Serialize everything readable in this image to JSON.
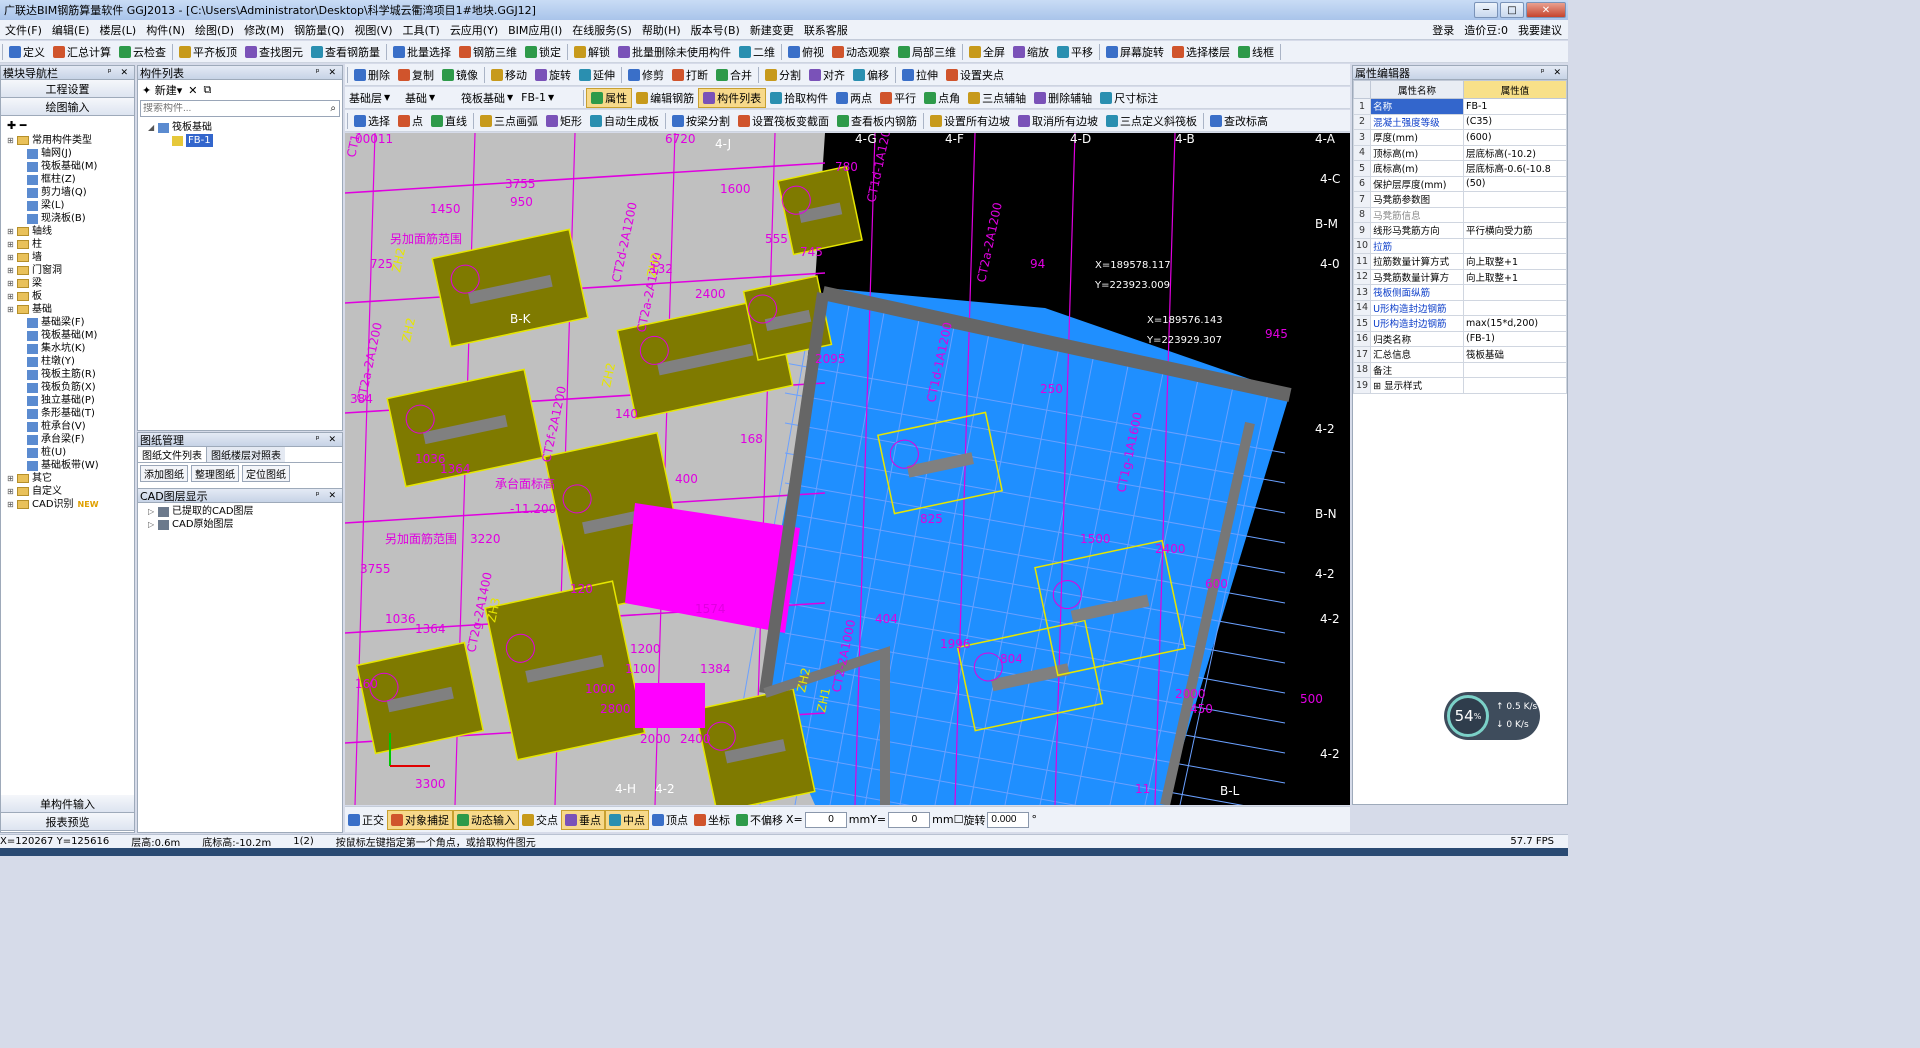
{
  "window": {
    "title": "广联达BIM钢筋算量软件 GGJ2013 - [C:\\Users\\Administrator\\Desktop\\科学城云衢湾项目1#地块.GGJ12]",
    "minimize": "─",
    "maximize": "□",
    "close": "✕"
  },
  "menu": {
    "items": [
      "文件(F)",
      "编辑(E)",
      "楼层(L)",
      "构件(N)",
      "绘图(D)",
      "修改(M)",
      "钢筋量(Q)",
      "视图(V)",
      "工具(T)",
      "云应用(Y)",
      "BIM应用(I)",
      "在线服务(S)",
      "帮助(H)",
      "版本号(B)",
      "新建变更",
      "联系客服"
    ],
    "right": [
      "登录",
      "造价豆:0",
      "我要建议"
    ]
  },
  "toolbar1": [
    "定义",
    "汇总计算",
    "云检查",
    "平齐板顶",
    "查找图元",
    "查看钢筋量",
    "批量选择",
    "钢筋三维",
    "锁定",
    "解锁",
    "批量删除未使用构件",
    "二维",
    "俯视",
    "动态观察",
    "局部三维",
    "全屏",
    "缩放",
    "平移",
    "屏幕旋转",
    "选择楼层",
    "线框"
  ],
  "toolbar2": [
    "删除",
    "复制",
    "镜像",
    "移动",
    "旋转",
    "延伸",
    "修剪",
    "打断",
    "合并",
    "分割",
    "对齐",
    "偏移",
    "拉伸",
    "设置夹点"
  ],
  "toolbar3": {
    "floor_type": "基础层",
    "floor": "基础",
    "category": "筏板基础",
    "member": "FB-1",
    "buttons": [
      "属性",
      "编辑钢筋",
      "构件列表",
      "拾取构件",
      "两点",
      "平行",
      "点角",
      "三点辅轴",
      "删除辅轴",
      "尺寸标注"
    ]
  },
  "toolbar4": [
    "选择",
    "点",
    "直线",
    "三点画弧",
    "矩形",
    "自动生成板",
    "按梁分割",
    "设置筏板变截面",
    "查看板内钢筋",
    "设置所有边坡",
    "取消所有边坡",
    "三点定义斜筏板",
    "查改标高"
  ],
  "nav": {
    "title": "模块导航栏",
    "btn1": "工程设置",
    "btn2": "绘图输入",
    "btn3": "单构件输入",
    "btn4": "报表预览",
    "tree": [
      {
        "t": "常用构件类型",
        "lvl": 0,
        "k": "fold"
      },
      {
        "t": "轴网(J)",
        "lvl": 1,
        "k": "item"
      },
      {
        "t": "筏板基础(M)",
        "lvl": 1,
        "k": "item"
      },
      {
        "t": "框柱(Z)",
        "lvl": 1,
        "k": "item"
      },
      {
        "t": "剪力墙(Q)",
        "lvl": 1,
        "k": "item"
      },
      {
        "t": "梁(L)",
        "lvl": 1,
        "k": "item"
      },
      {
        "t": "现浇板(B)",
        "lvl": 1,
        "k": "item"
      },
      {
        "t": "轴线",
        "lvl": 0,
        "k": "fold"
      },
      {
        "t": "柱",
        "lvl": 0,
        "k": "fold"
      },
      {
        "t": "墙",
        "lvl": 0,
        "k": "fold"
      },
      {
        "t": "门窗洞",
        "lvl": 0,
        "k": "fold"
      },
      {
        "t": "梁",
        "lvl": 0,
        "k": "fold"
      },
      {
        "t": "板",
        "lvl": 0,
        "k": "fold"
      },
      {
        "t": "基础",
        "lvl": 0,
        "k": "fold"
      },
      {
        "t": "基础梁(F)",
        "lvl": 1,
        "k": "item"
      },
      {
        "t": "筏板基础(M)",
        "lvl": 1,
        "k": "item"
      },
      {
        "t": "集水坑(K)",
        "lvl": 1,
        "k": "item"
      },
      {
        "t": "柱墩(Y)",
        "lvl": 1,
        "k": "item"
      },
      {
        "t": "筏板主筋(R)",
        "lvl": 1,
        "k": "item"
      },
      {
        "t": "筏板负筋(X)",
        "lvl": 1,
        "k": "item"
      },
      {
        "t": "独立基础(P)",
        "lvl": 1,
        "k": "item"
      },
      {
        "t": "条形基础(T)",
        "lvl": 1,
        "k": "item"
      },
      {
        "t": "桩承台(V)",
        "lvl": 1,
        "k": "item"
      },
      {
        "t": "承台梁(F)",
        "lvl": 1,
        "k": "item"
      },
      {
        "t": "桩(U)",
        "lvl": 1,
        "k": "item"
      },
      {
        "t": "基础板带(W)",
        "lvl": 1,
        "k": "item"
      },
      {
        "t": "其它",
        "lvl": 0,
        "k": "fold"
      },
      {
        "t": "自定义",
        "lvl": 0,
        "k": "fold"
      },
      {
        "t": "CAD识别",
        "lvl": 0,
        "k": "fold",
        "badge": "NEW"
      }
    ]
  },
  "comp": {
    "title": "构件列表",
    "new": "新建",
    "search_ph": "搜索构件...",
    "root": "筏板基础",
    "child": "FB-1"
  },
  "drawing": {
    "title": "图纸管理",
    "tab1": "图纸文件列表",
    "tab2": "图纸楼层对照表",
    "btns": [
      "添加图纸",
      "整理图纸",
      "定位图纸"
    ]
  },
  "cad": {
    "title": "CAD图层显示",
    "l1": "已提取的CAD图层",
    "l2": "CAD原始图层"
  },
  "props": {
    "title": "属性编辑器",
    "h_name": "属性名称",
    "h_val": "属性值",
    "rows": [
      {
        "n": "1",
        "k": "名称",
        "v": "FB-1",
        "c": "blue"
      },
      {
        "n": "2",
        "k": "混凝土强度等级",
        "v": "(C35)",
        "c": "blue"
      },
      {
        "n": "3",
        "k": "厚度(mm)",
        "v": "(600)",
        "c": ""
      },
      {
        "n": "4",
        "k": "顶标高(m)",
        "v": "层底标高(-10.2)",
        "c": ""
      },
      {
        "n": "5",
        "k": "底标高(m)",
        "v": "层底标高-0.6(-10.8",
        "c": ""
      },
      {
        "n": "6",
        "k": "保护层厚度(mm)",
        "v": "(50)",
        "c": ""
      },
      {
        "n": "7",
        "k": "马凳筋参数图",
        "v": "",
        "c": ""
      },
      {
        "n": "8",
        "k": "马凳筋信息",
        "v": "",
        "c": "gray"
      },
      {
        "n": "9",
        "k": "线形马凳筋方向",
        "v": "平行横向受力筋",
        "c": ""
      },
      {
        "n": "10",
        "k": "拉筋",
        "v": "",
        "c": "blue"
      },
      {
        "n": "11",
        "k": "拉筋数量计算方式",
        "v": "向上取整+1",
        "c": ""
      },
      {
        "n": "12",
        "k": "马凳筋数量计算方",
        "v": "向上取整+1",
        "c": ""
      },
      {
        "n": "13",
        "k": "筏板侧面纵筋",
        "v": "",
        "c": "blue"
      },
      {
        "n": "14",
        "k": "U形构造封边钢筋",
        "v": "",
        "c": "blue"
      },
      {
        "n": "15",
        "k": "U形构造封边钢筋",
        "v": "max(15*d,200)",
        "c": "blue"
      },
      {
        "n": "16",
        "k": "归类名称",
        "v": "(FB-1)",
        "c": ""
      },
      {
        "n": "17",
        "k": "汇总信息",
        "v": "筏板基础",
        "c": ""
      },
      {
        "n": "18",
        "k": "备注",
        "v": "",
        "c": ""
      },
      {
        "n": "19",
        "k": "⊞ 显示样式",
        "v": "",
        "c": ""
      }
    ]
  },
  "snap": {
    "items": [
      "正交",
      "对象捕捉",
      "动态输入",
      "交点",
      "垂点",
      "中点",
      "顶点",
      "坐标",
      "不偏移"
    ],
    "x_label": "X=",
    "x_val": "0",
    "y_label": "Y=",
    "y_val": "0",
    "unit": "mm",
    "rot_label": "旋转",
    "rot_val": "0.000",
    "deg": "°"
  },
  "status": {
    "coords": "X=120267 Y=125616",
    "floor_h": "层高:0.6m",
    "bottom": "底标高:-10.2m",
    "count": "1(2)",
    "hint": "按鼠标左键指定第一个角点，或拾取构件图元",
    "fps": "57.7 FPS"
  },
  "speed": {
    "pct": "54",
    "unit": "%",
    "up": "0.5",
    "up_u": "K/s",
    "down": "0",
    "down_u": "K/s"
  },
  "cadlabels": [
    "X=189578.117",
    "Y=223923.009",
    "X=189576.143",
    "Y=223929.307",
    "另加面筋范围",
    "另加面筋范围",
    "承台面标高",
    "-11.200",
    "CT1b-1A1200",
    "CT2d-2A1200",
    "CT2a-2A1200",
    "CT2a-2A1200",
    "CT2f-2A1200",
    "CT2g-2A1400",
    "CT2-2A1000",
    "CT1d-1A1200",
    "CT2a-2A1200",
    "CT1d-1A1200",
    "CT1g-1A1600",
    "ZH2",
    "ZH2",
    "ZH2",
    "ZH2",
    "ZH2",
    "ZH3",
    "ZH1",
    "1450",
    "950",
    "1600",
    "555",
    "745",
    "780",
    "2400",
    "132",
    "140",
    "168",
    "1036",
    "1364",
    "3220",
    "1036",
    "1364",
    "1100",
    "1574",
    "1384",
    "2800",
    "2000",
    "2400",
    "3300",
    "400",
    "120",
    "94",
    "945",
    "250",
    "2095",
    "1500",
    "2400",
    "600",
    "1996",
    "804",
    "2000",
    "450",
    "500",
    "1200",
    "1000",
    "3755",
    "725",
    "3755",
    "6720",
    "160",
    "384",
    "404",
    "825",
    "4-G",
    "4-F",
    "4-D",
    "4-B",
    "4-A",
    "4-H",
    "4-2",
    "B-L",
    "4-J",
    "4-C",
    "B-M",
    "B-N",
    "4-0",
    "4-2",
    "4-2",
    "4-2",
    "4-2",
    "11",
    "B-K",
    "00011"
  ]
}
